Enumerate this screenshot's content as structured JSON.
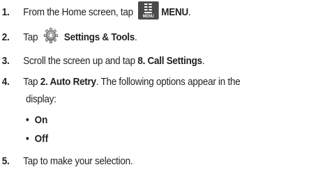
{
  "steps": [
    {
      "number": "1.",
      "text_before": "From the Home screen, tap",
      "icon": "menu-icon",
      "icon_caption": "MENU",
      "bold": "MENU",
      "text_after": "."
    },
    {
      "number": "2.",
      "text_before": "Tap",
      "icon": "settings-gear-icon",
      "bold": "Settings & Tools",
      "text_after": "."
    },
    {
      "number": "3.",
      "text_before": "Scroll the screen up and tap",
      "bold": "8. Call Settings",
      "text_after": "."
    },
    {
      "number": "4.",
      "text_before": "Tap",
      "bold": "2. Auto Retry",
      "text_after": ". The following options appear in the",
      "continuation": "display:",
      "options": [
        "On",
        "Off"
      ]
    },
    {
      "number": "5.",
      "text": "Tap to make your selection."
    }
  ]
}
